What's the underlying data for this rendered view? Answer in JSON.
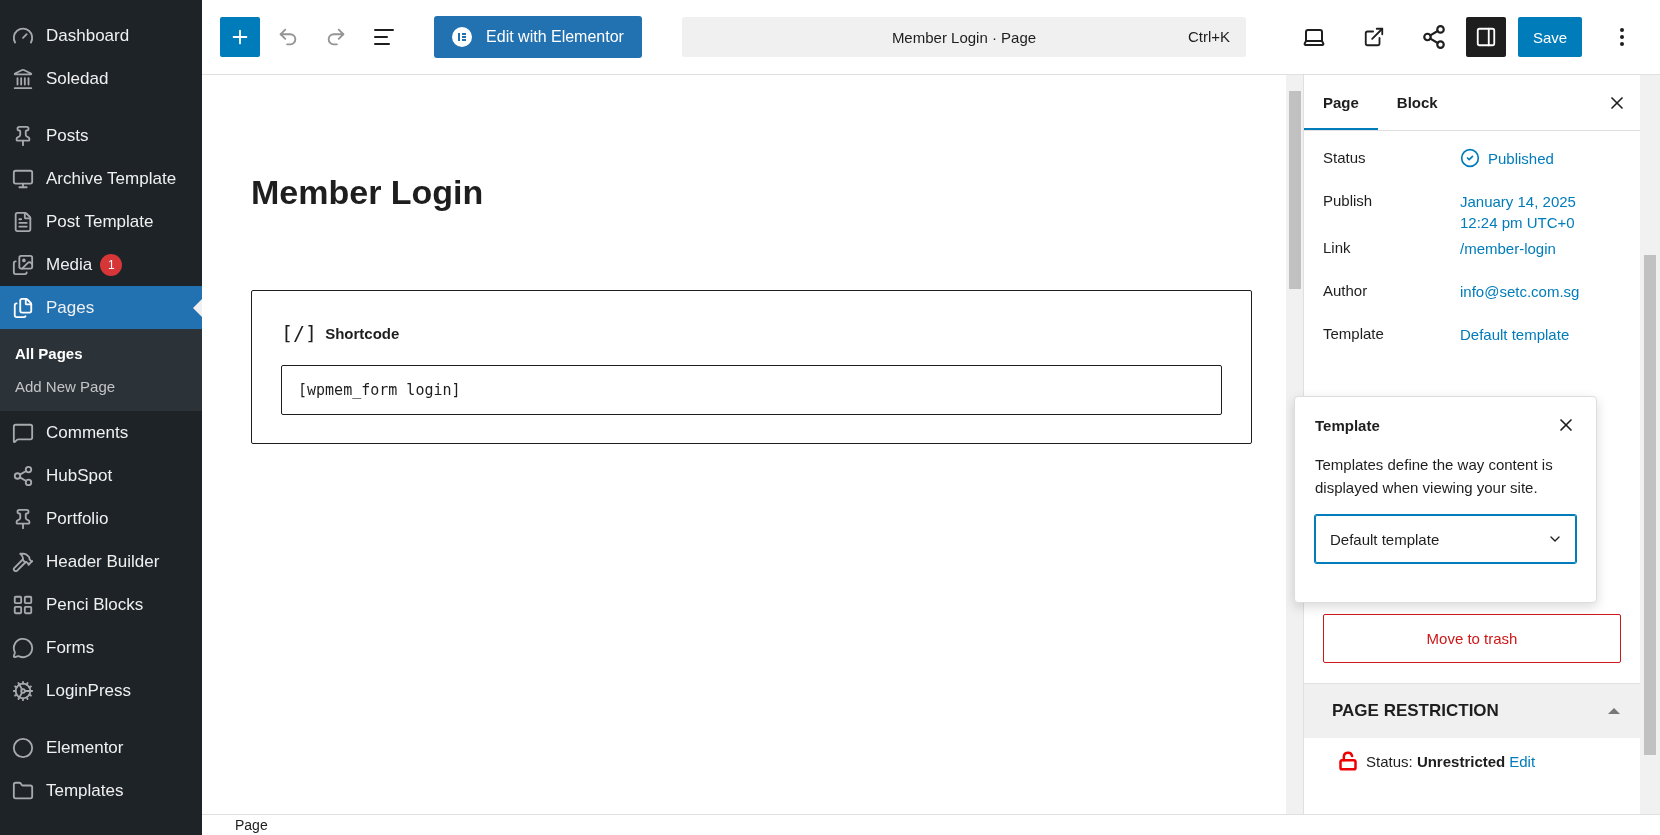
{
  "admin_menu": {
    "items": [
      {
        "label": "Dashboard",
        "selected": false
      },
      {
        "label": "Soledad",
        "selected": false
      },
      {
        "label": "Posts",
        "selected": false
      },
      {
        "label": "Archive Template",
        "selected": false
      },
      {
        "label": "Post Template",
        "selected": false
      },
      {
        "label": "Media",
        "selected": false,
        "badge": "1"
      },
      {
        "label": "Pages",
        "selected": true,
        "children": [
          {
            "label": "All Pages",
            "selected": true
          },
          {
            "label": "Add New Page",
            "selected": false
          }
        ]
      },
      {
        "label": "Comments",
        "selected": false
      },
      {
        "label": "HubSpot",
        "selected": false
      },
      {
        "label": "Portfolio",
        "selected": false
      },
      {
        "label": "Header Builder",
        "selected": false
      },
      {
        "label": "Penci Blocks",
        "selected": false
      },
      {
        "label": "Forms",
        "selected": false
      },
      {
        "label": "LoginPress",
        "selected": false
      },
      {
        "label": "Elementor",
        "selected": false
      },
      {
        "label": "Templates",
        "selected": false
      }
    ]
  },
  "toolbar": {
    "elementor_button": "Edit with Elementor",
    "command": "Member Login · Page",
    "shortcut": "Ctrl+K",
    "save_button": "Save"
  },
  "document": {
    "title": "Member Login",
    "block": {
      "icon_text": "[/]",
      "label": "Shortcode",
      "value": "[wpmem_form login]"
    }
  },
  "settings": {
    "tabs": [
      {
        "label": "Page",
        "selected": true
      },
      {
        "label": "Block",
        "selected": false
      }
    ],
    "rows": [
      {
        "kind": "status",
        "label": "Status",
        "value": [
          "Published"
        ]
      },
      {
        "kind": "link",
        "label": "Publish",
        "value": [
          "January 14, 2025",
          "12:24 pm UTC+0"
        ]
      },
      {
        "kind": "link",
        "label": "Link",
        "value": [
          "/member-login"
        ]
      },
      {
        "kind": "link",
        "label": "Author",
        "value": [
          "info@setc.com.sg"
        ]
      },
      {
        "kind": "link",
        "label": "Template",
        "value": [
          "Default template"
        ]
      }
    ],
    "popover": {
      "title": "Template",
      "description": "Templates define the way content is displayed when viewing your site.",
      "select_value": "Default template"
    },
    "trash_button": "Move to trash",
    "restriction": {
      "title": "PAGE RESTRICTION",
      "expanded": true,
      "status_label": "Status:",
      "status_value": "Unrestricted",
      "edit_link": "Edit"
    }
  },
  "status_bar": {
    "breadcrumb": "Page"
  }
}
